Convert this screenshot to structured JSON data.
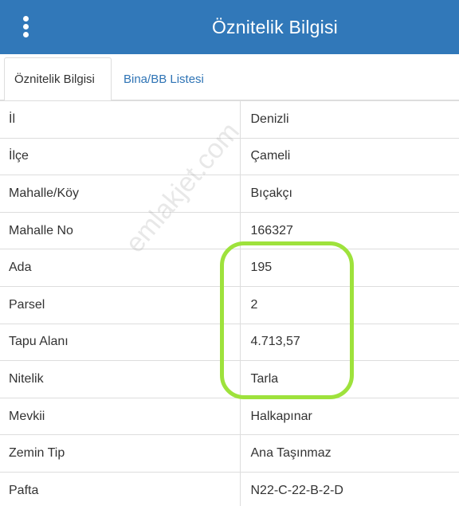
{
  "header": {
    "title": "Öznitelik Bilgisi",
    "menu_icon": "vertical-dots-icon",
    "background_color": "#3178b9"
  },
  "tabs": [
    {
      "label": "Öznitelik Bilgisi",
      "active": true
    },
    {
      "label": "Bina/BB Listesi",
      "active": false
    }
  ],
  "rows": [
    {
      "key": "İl",
      "value": "Denizli"
    },
    {
      "key": "İlçe",
      "value": "Çameli"
    },
    {
      "key": "Mahalle/Köy",
      "value": "Bıçakçı"
    },
    {
      "key": "Mahalle No",
      "value": "166327"
    },
    {
      "key": "Ada",
      "value": "195"
    },
    {
      "key": "Parsel",
      "value": "2"
    },
    {
      "key": "Tapu Alanı",
      "value": "4.713,57"
    },
    {
      "key": "Nitelik",
      "value": "Tarla"
    },
    {
      "key": "Mevkii",
      "value": "Halkapınar"
    },
    {
      "key": "Zemin Tip",
      "value": "Ana Taşınmaz"
    },
    {
      "key": "Pafta",
      "value": "N22-C-22-B-2-D"
    }
  ],
  "watermark": "emlakjet.com",
  "highlight_color": "#9ee23c"
}
